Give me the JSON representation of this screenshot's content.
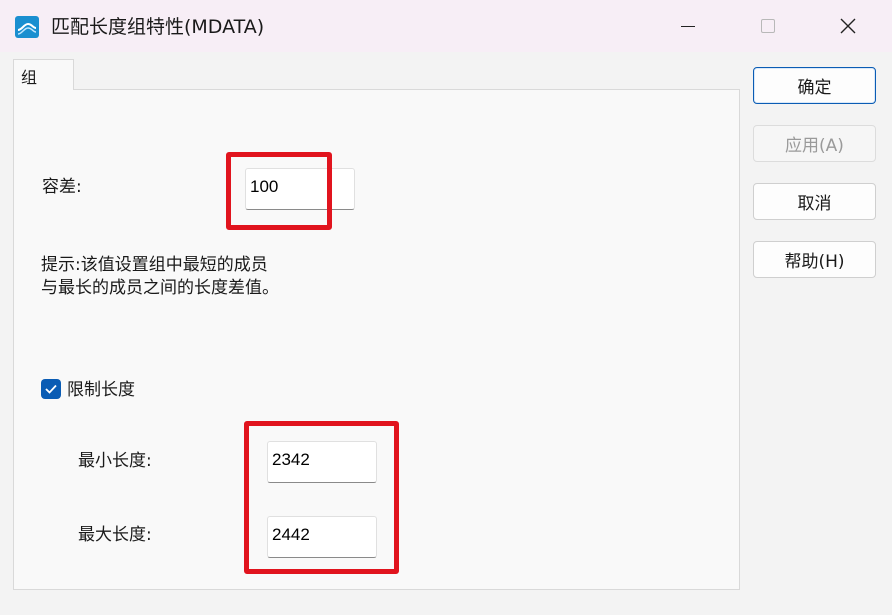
{
  "window": {
    "title": "匹配长度组特性(MDATA)",
    "icon": "chart-line-icon",
    "controls": [
      "minimize-icon",
      "maximize-icon",
      "close-icon"
    ]
  },
  "tab": {
    "label": "组"
  },
  "tolerance": {
    "label": "容差:",
    "value": "100"
  },
  "hint": {
    "line1": "提示:该值设置组中最短的成员",
    "line2": "与最长的成员之间的长度差值。"
  },
  "limit_length": {
    "label": "限制长度",
    "checked": true
  },
  "min_length": {
    "label": "最小长度:",
    "value": "2342"
  },
  "max_length": {
    "label": "最大长度:",
    "value": "2442"
  },
  "buttons": {
    "ok": "确定",
    "apply": "应用(A)",
    "cancel": "取消",
    "help": "帮助(H)"
  },
  "colors": {
    "highlight": "#e1141e",
    "accent": "#0a5cb4",
    "titlebar": "#f7eef6"
  }
}
